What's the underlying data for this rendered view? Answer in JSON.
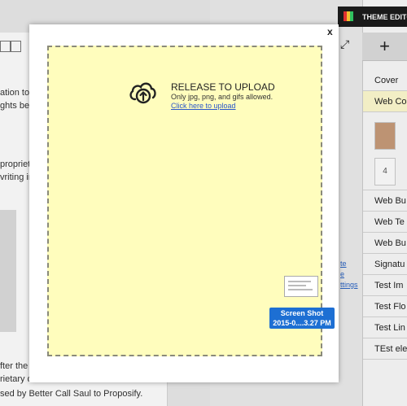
{
  "background": {
    "doc_text_lines": [
      "ation to u",
      "ghts belo",
      "proprieta",
      "vriting in",
      "fter the t",
      "rietary d",
      "sed by Better Call Saul to Proposify."
    ],
    "side_links": [
      "te",
      "e",
      "ttings"
    ],
    "theme_editor_label": "THEME EDITOR",
    "add_label": "+",
    "panel_items": [
      "Cover",
      "Web Co",
      "Web Bu",
      "Web Te",
      "Web Bu",
      "Signatu",
      "Test Im",
      "Test Flo",
      "Test Lin",
      "TEst ele"
    ],
    "thumb_page_number": "4"
  },
  "modal": {
    "close_label": "x",
    "title": "RELEASE TO UPLOAD",
    "subtitle": "Only jpg, png, and gifs allowed.",
    "link_text": "Click here to upload",
    "dropzone_color": "#fffdbd"
  },
  "drag_file": {
    "line1": "Screen Shot",
    "line2": "2015-0....3.27 PM",
    "label_color": "#1d6fd3"
  },
  "icons": [
    "upload-cloud-icon",
    "expand-icon",
    "theme-grid-icon",
    "close-icon"
  ]
}
